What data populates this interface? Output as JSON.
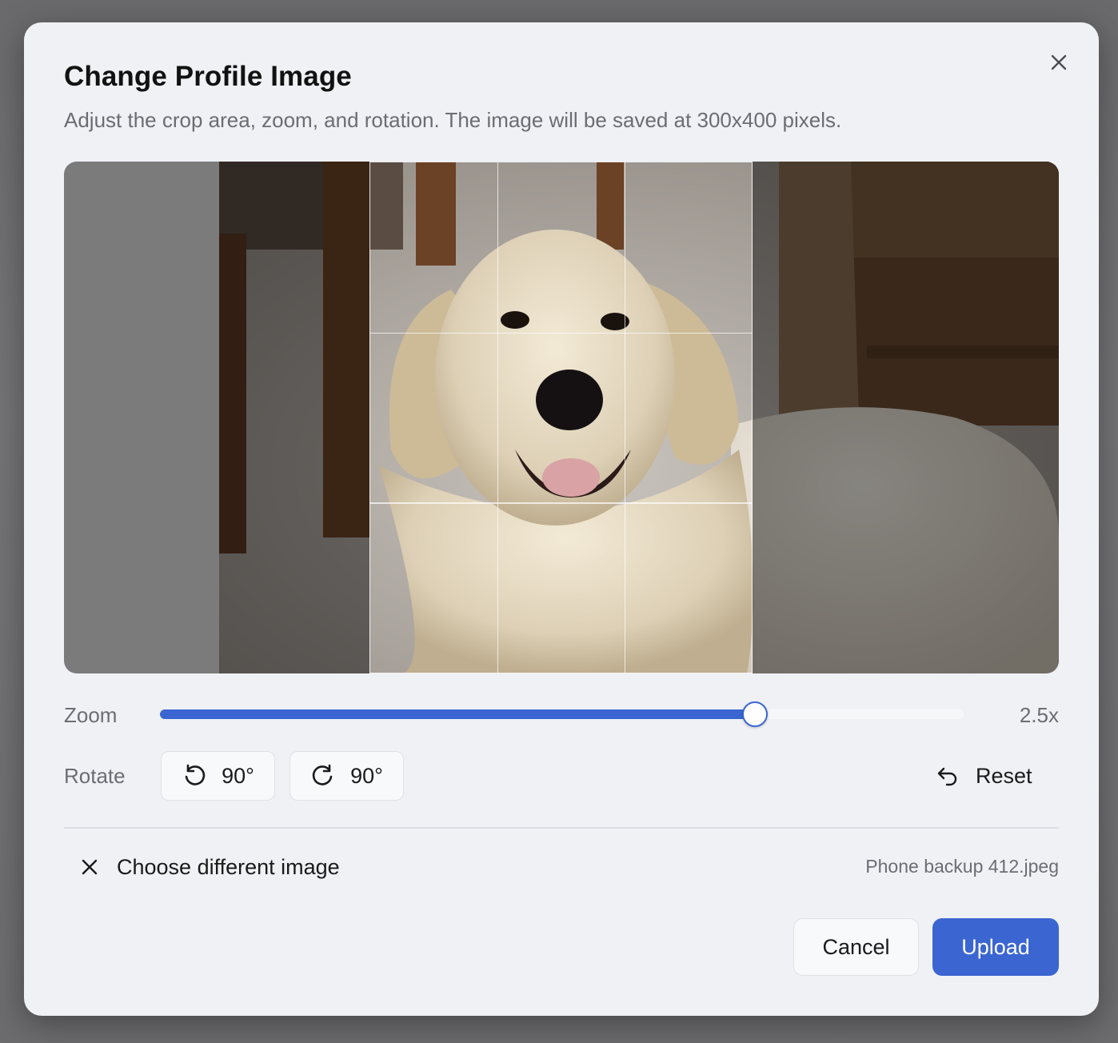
{
  "dialog": {
    "title": "Change Profile Image",
    "subtitle": "Adjust the crop area, zoom, and rotation. The image will be saved at 300x400 pixels."
  },
  "zoom": {
    "label": "Zoom",
    "value_text": "2.5x",
    "slider_fraction": 0.74
  },
  "rotate": {
    "label": "Rotate",
    "left_label": "90°",
    "right_label": "90°"
  },
  "reset": {
    "label": "Reset"
  },
  "choose": {
    "label": "Choose different image"
  },
  "file": {
    "name": "Phone backup 412.jpeg"
  },
  "actions": {
    "cancel": "Cancel",
    "upload": "Upload"
  },
  "colors": {
    "accent": "#3b66d1",
    "dialog_bg": "#eff1f5",
    "muted_text": "#6b6d72"
  },
  "icons": {
    "close": "close-icon",
    "rotate_left": "rotate-ccw-icon",
    "rotate_right": "rotate-cw-icon",
    "reset": "undo-icon",
    "choose": "x-icon"
  }
}
